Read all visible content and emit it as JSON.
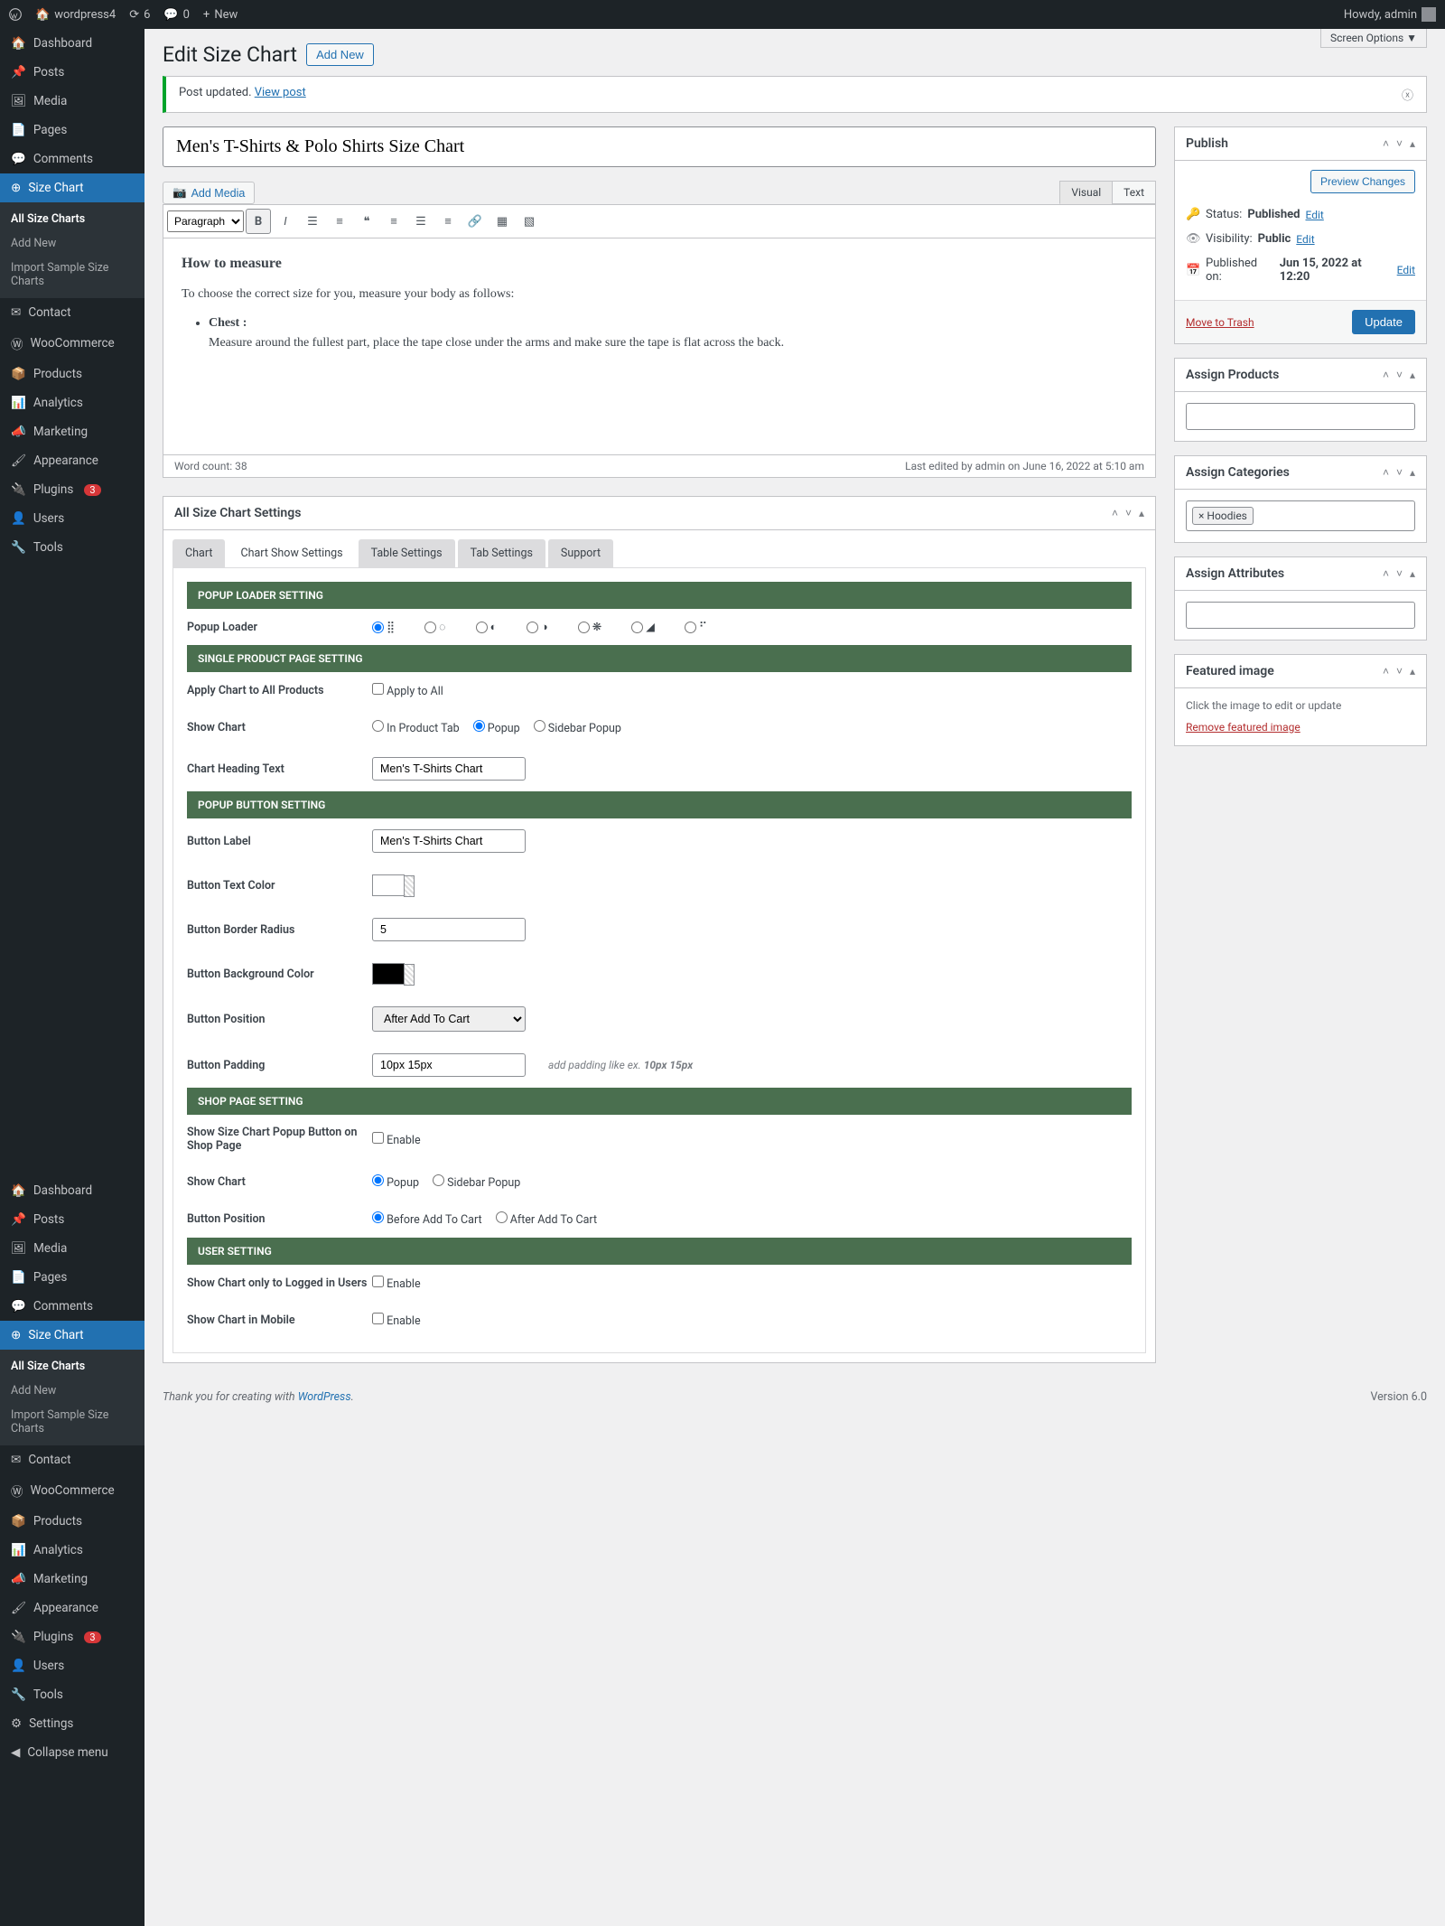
{
  "adminbar": {
    "site": "wordpress4",
    "updates": "6",
    "comments": "0",
    "new": "New",
    "howdy": "Howdy, admin"
  },
  "sidebar": {
    "menu1": [
      "Dashboard",
      "Posts",
      "Media",
      "Pages",
      "Comments",
      "Size Chart"
    ],
    "submenu1": [
      "All Size Charts",
      "Add New",
      "Import Sample Size Charts"
    ],
    "menu2": [
      "Contact",
      "WooCommerce",
      "Products",
      "Analytics",
      "Marketing",
      "Appearance",
      "Plugins",
      "Users",
      "Tools"
    ],
    "plugins_badge": "3",
    "menu3": [
      "Dashboard",
      "Posts",
      "Media",
      "Pages",
      "Comments",
      "Size Chart"
    ],
    "submenu2": [
      "All Size Charts",
      "Add New",
      "Import Sample Size Charts"
    ],
    "menu4": [
      "Contact",
      "WooCommerce",
      "Products",
      "Analytics",
      "Marketing",
      "Appearance",
      "Plugins",
      "Users",
      "Tools",
      "Settings"
    ],
    "collapse": "Collapse menu"
  },
  "screenOptions": "Screen Options ▼",
  "page": {
    "title": "Edit Size Chart",
    "addNew": "Add New"
  },
  "notice": {
    "msg": "Post updated.",
    "link": "View post"
  },
  "postTitle": "Men's T-Shirts & Polo Shirts Size Chart",
  "editor": {
    "addMedia": "Add Media",
    "tabs": {
      "visual": "Visual",
      "text": "Text"
    },
    "format": "Paragraph",
    "body": {
      "heading": "How to measure",
      "para": "To choose the correct size for you, measure your body as follows:",
      "li_label": "Chest :",
      "li_text": "Measure around the fullest part, place the tape close under the arms and make sure the tape is flat across the back."
    },
    "wordcount": "Word count: 38",
    "lastEdit": "Last edited by admin on June 16, 2022 at 5:10 am"
  },
  "publish": {
    "title": "Publish",
    "preview": "Preview Changes",
    "status_lbl": "Status:",
    "status_val": "Published",
    "vis_lbl": "Visibility:",
    "vis_val": "Public",
    "pub_lbl": "Published on:",
    "pub_val": "Jun 15, 2022 at 12:20",
    "edit": "Edit",
    "trash": "Move to Trash",
    "update": "Update"
  },
  "assignProducts": {
    "title": "Assign Products"
  },
  "assignCategories": {
    "title": "Assign Categories",
    "tag": "× Hoodies"
  },
  "assignAttributes": {
    "title": "Assign Attributes"
  },
  "featuredImage": {
    "title": "Featured image",
    "hint": "Click the image to edit or update",
    "remove": "Remove featured image"
  },
  "settingsBox": {
    "title": "All Size Chart Settings",
    "tabs": [
      "Chart",
      "Chart Show Settings",
      "Table Settings",
      "Tab Settings",
      "Support"
    ],
    "sec1": "POPUP LOADER SETTING",
    "popupLoader": "Popup Loader",
    "sec2": "SINGLE PRODUCT PAGE SETTING",
    "applyAll_lbl": "Apply Chart to All Products",
    "applyAll_opt": "Apply to All",
    "showChart_lbl": "Show Chart",
    "showChart_opts": [
      "In Product Tab",
      "Popup",
      "Sidebar Popup"
    ],
    "headingText_lbl": "Chart Heading Text",
    "headingText_val": "Men's T-Shirts Chart",
    "sec3": "POPUP BUTTON SETTING",
    "btnLabel_lbl": "Button Label",
    "btnLabel_val": "Men's T-Shirts Chart",
    "btnTextColor_lbl": "Button Text Color",
    "btnRadius_lbl": "Button Border Radius",
    "btnRadius_val": "5",
    "btnBg_lbl": "Button Background Color",
    "btnPos_lbl": "Button Position",
    "btnPos_val": "After Add To Cart",
    "btnPad_lbl": "Button Padding",
    "btnPad_val": "10px 15px",
    "btnPad_hint_pre": "add padding like ex. ",
    "btnPad_hint_b": "10px 15px",
    "sec4": "SHOP PAGE SETTING",
    "shopBtn_lbl": "Show Size Chart Popup Button on Shop Page",
    "enable": "Enable",
    "shopShowChart_lbl": "Show Chart",
    "shopShowChart_opts": [
      "Popup",
      "Sidebar Popup"
    ],
    "shopBtnPos_lbl": "Button Position",
    "shopBtnPos_opts": [
      "Before Add To Cart",
      "After Add To Cart"
    ],
    "sec5": "USER SETTING",
    "loggedIn_lbl": "Show Chart only to Logged in Users",
    "mobile_lbl": "Show Chart in Mobile"
  },
  "footer": {
    "thank_pre": "Thank you for creating with ",
    "wp": "WordPress",
    "version": "Version 6.0"
  }
}
